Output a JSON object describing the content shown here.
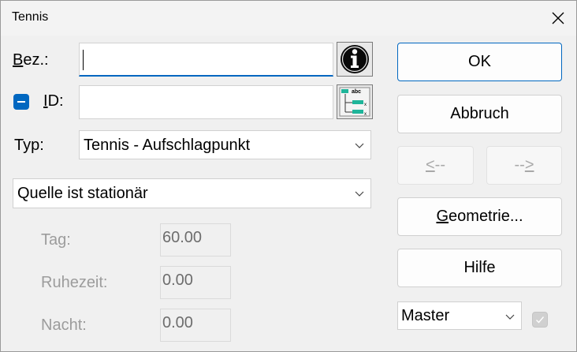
{
  "window": {
    "title": "Tennis"
  },
  "fields": {
    "bez_label_u": "B",
    "bez_label_rest": "ez.:",
    "bez_value": "",
    "id_label_u": "I",
    "id_label_rest": "D:",
    "id_value": "",
    "typ_label": "Typ:",
    "typ_value": "Tennis - Aufschlagpunkt",
    "source_value": "Quelle ist stationär"
  },
  "times": [
    {
      "label": "Tag:",
      "value": "60.00"
    },
    {
      "label": "Ruhezeit:",
      "value": "0.00"
    },
    {
      "label": "Nacht:",
      "value": "0.00"
    }
  ],
  "buttons": {
    "ok": "OK",
    "cancel": "Abbruch",
    "prev_u": "<",
    "prev_rest": "--",
    "next_rest": "--",
    "next_u": ">",
    "geometry_u": "G",
    "geometry_rest": "eometrie...",
    "help": "Hilfe"
  },
  "master": {
    "value": "Master"
  },
  "colors": {
    "accent": "#0067c0",
    "disabled_text": "#9c9c9c",
    "list_icon_teal": "#1fb59a"
  }
}
